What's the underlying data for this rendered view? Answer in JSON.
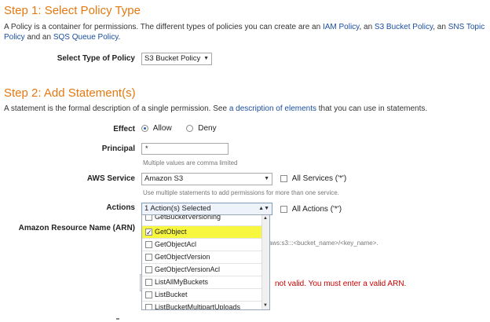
{
  "step1": {
    "title": "Step 1: Select Policy Type",
    "desc_part1": "A Policy is a container for permissions. The different types of policies you can create are an ",
    "link_iam": "IAM Policy",
    "sep1": ", an ",
    "link_s3": "S3 Bucket Policy",
    "sep2": ", an ",
    "link_sns": "SNS Topic",
    "link_sns_2": "Policy",
    "sep3": " and an ",
    "link_sqs": "SQS Queue Policy",
    "end": ".",
    "select_label": "Select Type of Policy",
    "select_value": "S3 Bucket Policy"
  },
  "step2": {
    "title": "Step 2: Add Statement(s)",
    "desc_part1": "A statement is the formal description of a single permission. See ",
    "desc_link": "a description of elements",
    "desc_part2": " that you can use in statements.",
    "effect_label": "Effect",
    "effect_allow": "Allow",
    "effect_deny": "Deny",
    "principal_label": "Principal",
    "principal_value": "*",
    "principal_hint": "Multiple values are comma limited",
    "service_label": "AWS Service",
    "service_value": "Amazon S3",
    "all_services": "All Services ('*')",
    "service_hint": "Use multiple statements to add permissions for more than one service.",
    "actions_label": "Actions",
    "actions_value": "1 Action(s) Selected",
    "all_actions": "All Actions ('*')",
    "arn_label": "Amazon Resource Name (ARN)",
    "arn_hint": "aws:s3:::<bucket_name>/<key_name>.",
    "arn_error": "not valid. You must enter a valid ARN."
  },
  "actions_list": [
    {
      "label": "GetBucketVersioning",
      "checked": false,
      "selected": false
    },
    {
      "label": "GetObject",
      "checked": true,
      "selected": true
    },
    {
      "label": "GetObjectAcl",
      "checked": false,
      "selected": false
    },
    {
      "label": "GetObjectVersion",
      "checked": false,
      "selected": false
    },
    {
      "label": "GetObjectVersionAcl",
      "checked": false,
      "selected": false
    },
    {
      "label": "ListAllMyBuckets",
      "checked": false,
      "selected": false
    },
    {
      "label": "ListBucket",
      "checked": false,
      "selected": false
    },
    {
      "label": "ListBucketMultipartUploads",
      "checked": false,
      "selected": false
    }
  ],
  "colors": {
    "heading": "#e47911",
    "link": "#1a4ea0",
    "highlight": "#f7f740",
    "error": "#cc0000"
  }
}
